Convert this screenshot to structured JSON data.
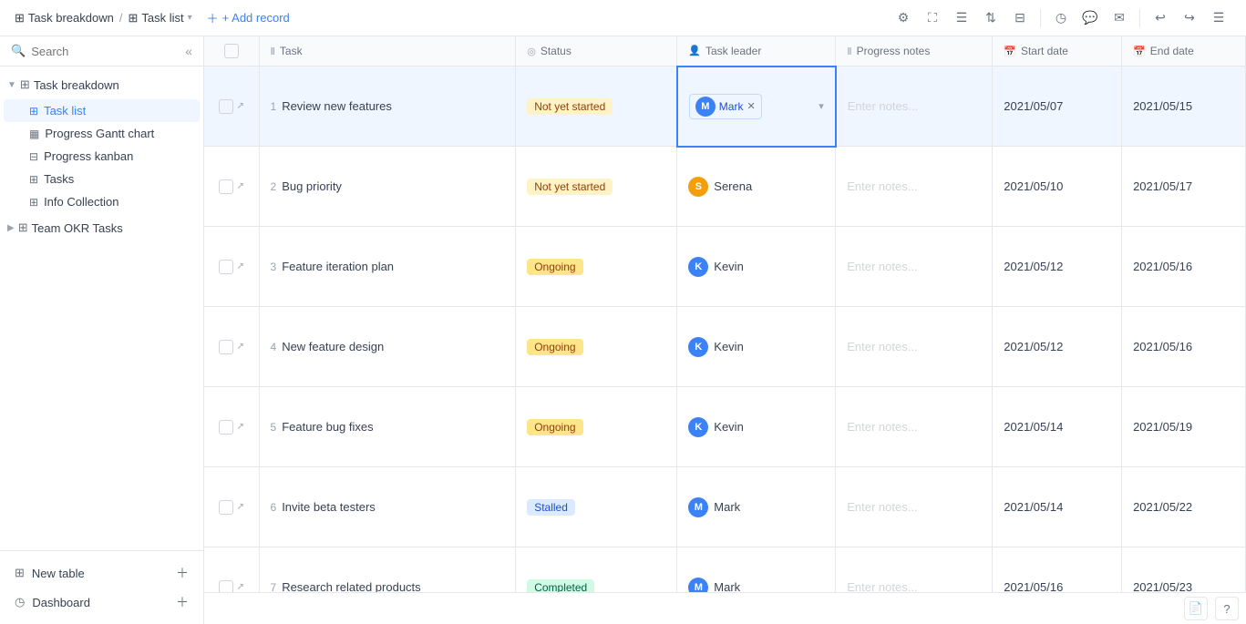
{
  "topbar": {
    "breadcrumb": [
      {
        "label": "Task breakdown",
        "icon": "grid-icon"
      },
      {
        "label": "Task list",
        "icon": "grid-icon"
      }
    ],
    "add_record": "+ Add record",
    "icons": [
      "settings-icon",
      "filter-icon",
      "text-icon",
      "sort-icon",
      "group-icon",
      "history-icon",
      "comment-icon",
      "chat-icon",
      "undo-icon",
      "redo-icon",
      "summary-icon"
    ]
  },
  "sidebar": {
    "search_placeholder": "Search",
    "groups": [
      {
        "label": "Task breakdown",
        "expanded": true,
        "items": [
          {
            "label": "Task list",
            "icon": "grid-icon",
            "active": true
          },
          {
            "label": "Progress Gantt chart",
            "icon": "gantt-icon",
            "active": false
          },
          {
            "label": "Progress kanban",
            "icon": "kanban-icon",
            "active": false
          },
          {
            "label": "Tasks",
            "icon": "grid-icon",
            "active": false
          },
          {
            "label": "Info Collection",
            "icon": "grid-icon",
            "active": false
          }
        ]
      },
      {
        "label": "Team OKR Tasks",
        "expanded": false,
        "items": []
      }
    ],
    "bottom": [
      {
        "label": "New table",
        "icon": "plus-icon"
      },
      {
        "label": "Dashboard",
        "icon": "dashboard-icon"
      }
    ]
  },
  "table": {
    "columns": [
      {
        "label": "",
        "icon": ""
      },
      {
        "label": "Task",
        "icon": "text-icon"
      },
      {
        "label": "Status",
        "icon": "status-icon"
      },
      {
        "label": "Task leader",
        "icon": "person-icon"
      },
      {
        "label": "Progress notes",
        "icon": "text-icon"
      },
      {
        "label": "Start date",
        "icon": "calendar-icon"
      },
      {
        "label": "End date",
        "icon": "calendar-icon"
      }
    ],
    "rows": [
      {
        "num": 1,
        "task": "Review new features",
        "status": "Not yet started",
        "status_class": "status-not-started",
        "leader": "Mark",
        "leader_avatar": "M",
        "leader_avatar_class": "avatar-m",
        "notes_placeholder": "Enter notes...",
        "start_date": "2021/05/07",
        "end_date": "2021/05/15",
        "selected": true,
        "leader_cell_selected": true
      },
      {
        "num": 2,
        "task": "Bug priority",
        "status": "Not yet started",
        "status_class": "status-not-started",
        "leader": "Serena",
        "leader_avatar": "S",
        "leader_avatar_class": "avatar-s",
        "notes_placeholder": "Enter notes...",
        "start_date": "2021/05/10",
        "end_date": "2021/05/17",
        "selected": false,
        "leader_cell_selected": false
      },
      {
        "num": 3,
        "task": "Feature iteration plan",
        "status": "Ongoing",
        "status_class": "status-ongoing",
        "leader": "Kevin",
        "leader_avatar": "K",
        "leader_avatar_class": "avatar-k",
        "notes_placeholder": "Enter notes...",
        "start_date": "2021/05/12",
        "end_date": "2021/05/16",
        "selected": false,
        "leader_cell_selected": false
      },
      {
        "num": 4,
        "task": "New feature design",
        "status": "Ongoing",
        "status_class": "status-ongoing",
        "leader": "Kevin",
        "leader_avatar": "K",
        "leader_avatar_class": "avatar-k",
        "notes_placeholder": "Enter notes...",
        "start_date": "2021/05/12",
        "end_date": "2021/05/16",
        "selected": false,
        "leader_cell_selected": false
      },
      {
        "num": 5,
        "task": "Feature bug fixes",
        "status": "Ongoing",
        "status_class": "status-ongoing",
        "leader": "Kevin",
        "leader_avatar": "K",
        "leader_avatar_class": "avatar-k",
        "notes_placeholder": "Enter notes...",
        "start_date": "2021/05/14",
        "end_date": "2021/05/19",
        "selected": false,
        "leader_cell_selected": false
      },
      {
        "num": 6,
        "task": "Invite beta testers",
        "status": "Stalled",
        "status_class": "status-stalled",
        "leader": "Mark",
        "leader_avatar": "M",
        "leader_avatar_class": "avatar-m",
        "notes_placeholder": "Enter notes...",
        "start_date": "2021/05/14",
        "end_date": "2021/05/22",
        "selected": false,
        "leader_cell_selected": false
      },
      {
        "num": 7,
        "task": "Research related products",
        "status": "Completed",
        "status_class": "status-completed",
        "leader": "Mark",
        "leader_avatar": "M",
        "leader_avatar_class": "avatar-m",
        "notes_placeholder": "Enter notes...",
        "start_date": "2021/05/16",
        "end_date": "2021/05/23",
        "selected": false,
        "leader_cell_selected": false
      }
    ]
  },
  "colors": {
    "accent": "#3b82f6",
    "sidebar_active_bg": "#eff6ff",
    "sidebar_active_text": "#3b82f6"
  }
}
